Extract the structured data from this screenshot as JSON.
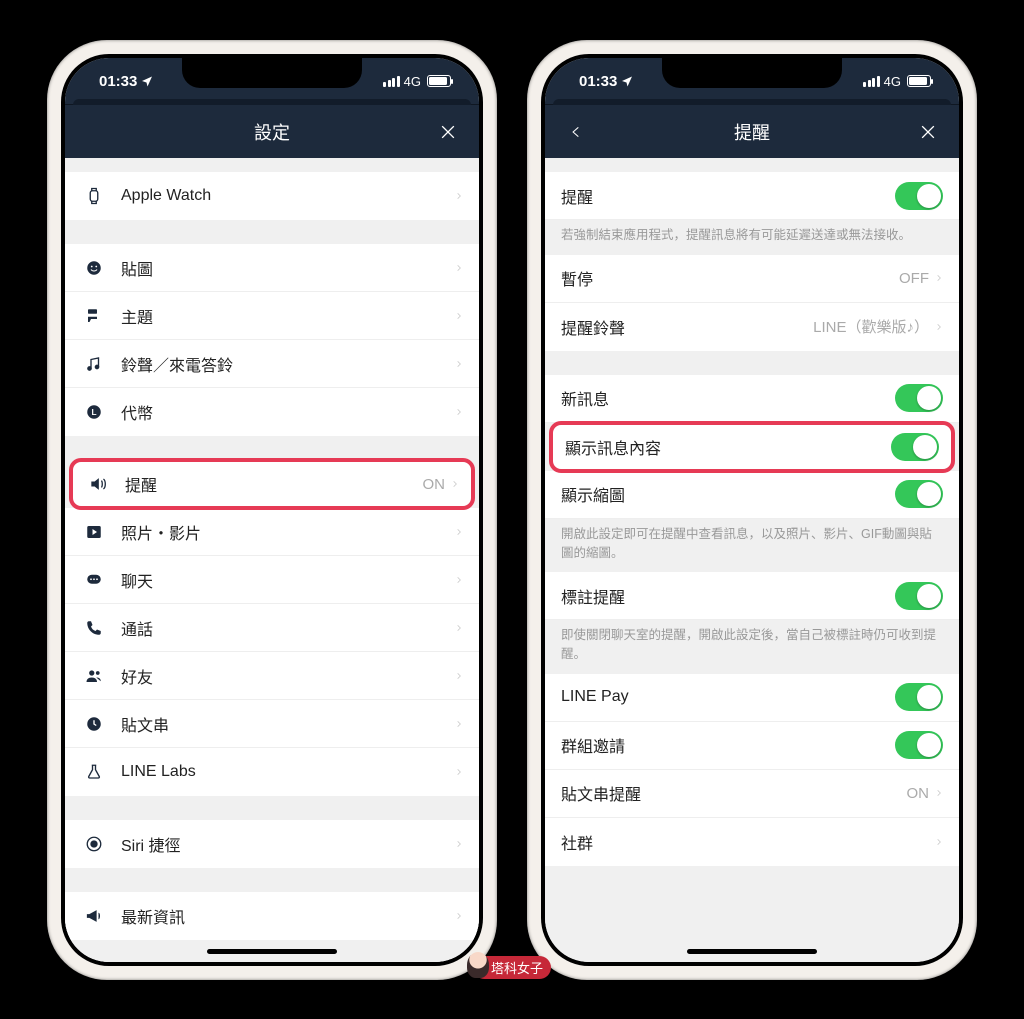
{
  "status": {
    "time": "01:33",
    "network": "4G"
  },
  "left": {
    "title": "設定",
    "groups": [
      [
        {
          "id": "apple-watch",
          "label": "Apple Watch",
          "icon": "watch"
        }
      ],
      [
        {
          "id": "stickers",
          "label": "貼圖",
          "icon": "smile"
        },
        {
          "id": "themes",
          "label": "主題",
          "icon": "brush"
        },
        {
          "id": "ringtone",
          "label": "鈴聲／來電答鈴",
          "icon": "music"
        },
        {
          "id": "coins",
          "label": "代幣",
          "icon": "coin"
        }
      ],
      [
        {
          "id": "notifications",
          "label": "提醒",
          "icon": "speaker",
          "value": "ON",
          "highlight": true
        },
        {
          "id": "photos",
          "label": "照片・影片",
          "icon": "play"
        },
        {
          "id": "chats",
          "label": "聊天",
          "icon": "chat"
        },
        {
          "id": "calls",
          "label": "通話",
          "icon": "phone"
        },
        {
          "id": "friends",
          "label": "好友",
          "icon": "friends"
        },
        {
          "id": "timeline",
          "label": "貼文串",
          "icon": "clock"
        },
        {
          "id": "line-labs",
          "label": "LINE Labs",
          "icon": "flask"
        }
      ],
      [
        {
          "id": "siri",
          "label": "Siri 捷徑",
          "icon": "siri"
        }
      ],
      [
        {
          "id": "news",
          "label": "最新資訊",
          "icon": "megaphone"
        }
      ]
    ]
  },
  "right": {
    "title": "提醒",
    "sections": [
      {
        "rows": [
          {
            "id": "notif-master",
            "label": "提醒",
            "toggle": true
          }
        ],
        "footer": "若強制結束應用程式，提醒訊息將有可能延遲送達或無法接收。"
      },
      {
        "rows": [
          {
            "id": "pause",
            "label": "暫停",
            "value": "OFF",
            "chev": true
          },
          {
            "id": "notif-sound",
            "label": "提醒鈴聲",
            "value": "LINE（歡樂版♪）",
            "chev": true
          }
        ]
      },
      {
        "rows": [
          {
            "id": "new-msg",
            "label": "新訊息",
            "toggle": true
          },
          {
            "id": "show-content",
            "label": "顯示訊息內容",
            "toggle": true,
            "highlight": true
          },
          {
            "id": "show-thumb",
            "label": "顯示縮圖",
            "toggle": true
          }
        ],
        "footer": "開啟此設定即可在提醒中查看訊息，以及照片、影片、GIF動圖與貼圖的縮圖。"
      },
      {
        "rows": [
          {
            "id": "mention",
            "label": "標註提醒",
            "toggle": true
          }
        ],
        "footer": "即使關閉聊天室的提醒，開啟此設定後，當自己被標註時仍可收到提醒。"
      },
      {
        "rows": [
          {
            "id": "line-pay",
            "label": "LINE Pay",
            "toggle": true
          },
          {
            "id": "group-invite",
            "label": "群組邀請",
            "toggle": true
          },
          {
            "id": "timeline-notif",
            "label": "貼文串提醒",
            "value": "ON",
            "chev": true
          },
          {
            "id": "openchat",
            "label": "社群",
            "chev": true
          }
        ]
      }
    ]
  },
  "watermark": "塔科女子"
}
